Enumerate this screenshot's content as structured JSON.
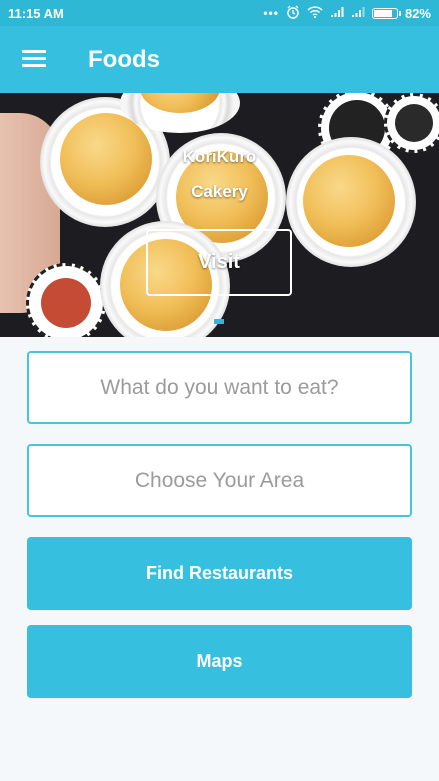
{
  "status_bar": {
    "time": "11:15 AM",
    "battery": "82%",
    "battery_level": 0.82,
    "icons": [
      "more-dots-icon",
      "alarm-icon",
      "wifi-icon",
      "signal-icon",
      "signal-icon",
      "battery-icon"
    ]
  },
  "app_bar": {
    "title": "Foods",
    "menu_icon": "hamburger-menu-icon"
  },
  "hero": {
    "title_line1": "KoriKuro",
    "title_line2": "Cakery",
    "visit_label": "Visit"
  },
  "search": {
    "food_placeholder": "What do you want to eat?",
    "area_placeholder": "Choose Your Area"
  },
  "actions": {
    "find_label": "Find Restaurants",
    "maps_label": "Maps"
  },
  "colors": {
    "primary": "#37bfdf",
    "status_bar": "#2fb8d6",
    "background": "#f4f8fb"
  }
}
